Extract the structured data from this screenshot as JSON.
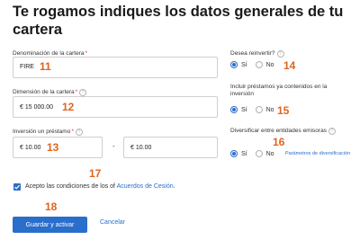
{
  "title": "Te rogamos indiques los datos generales de tu cartera",
  "form": {
    "portfolio_name": {
      "label": "Denominación de la cartera",
      "required_mark": "*",
      "value": "FIRE",
      "badge": "11"
    },
    "portfolio_size": {
      "label": "Dimensión de la cartera",
      "required_mark": "*",
      "value": "€ 15 000.00",
      "badge": "12"
    },
    "loan_investment": {
      "label": "Inversión un préstamo",
      "required_mark": "*",
      "min_value": "€ 10.00",
      "max_value": "€ 10.00",
      "separator": "-",
      "badge": "13"
    },
    "reinvest": {
      "label": "Desea reinvertir?",
      "options": [
        "Sí",
        "No"
      ],
      "selected": "Sí",
      "badge": "14"
    },
    "include_loans": {
      "label": "Incluir préstamos ya contenidos en la inversión",
      "options": [
        "Sí",
        "No"
      ],
      "selected": "Sí",
      "badge": "15"
    },
    "diversify": {
      "label": "Diversificar entre entidades emisoras",
      "options": [
        "Sí",
        "No"
      ],
      "selected": "Sí",
      "link": "Parámetros de diversificación",
      "badge": "16"
    },
    "terms": {
      "prefix": "Acepto las condiciones de los of",
      "link": "Acuerdos de Cesión",
      "suffix": ".",
      "checked": true,
      "badge": "17"
    }
  },
  "actions": {
    "save_label": "Guardar y activar",
    "cancel_label": "Cancelar",
    "badge": "18"
  },
  "colors": {
    "accent": "#2a6ecb",
    "badge": "#e0641c",
    "required": "#d33333"
  },
  "icons": {
    "help": "question-circle-icon",
    "check": "check-icon"
  }
}
